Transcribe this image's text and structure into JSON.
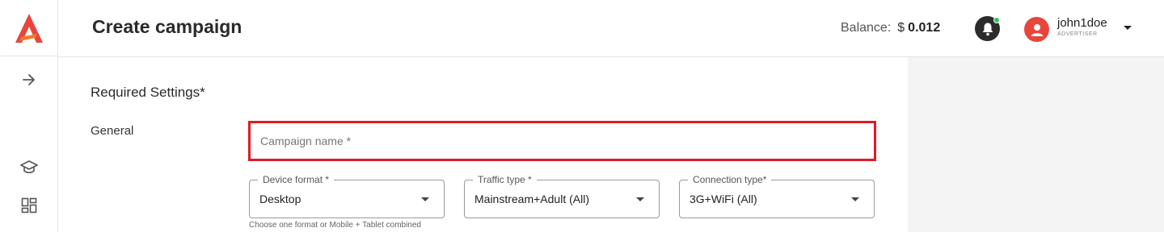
{
  "header": {
    "title": "Create campaign",
    "balance_label": "Balance:",
    "balance_currency": "$",
    "balance_amount": "0.012",
    "notification_dot_color": "#36c25f"
  },
  "user": {
    "username": "john1doe",
    "role": "ADVERTISER",
    "avatar_color": "#e8453c"
  },
  "brand": {
    "logo_color": "#e8453c"
  },
  "sidebar": {
    "items": [
      {
        "icon": "arrow-right-icon"
      },
      {
        "icon": "graduation-cap-icon"
      },
      {
        "icon": "dashboard-grid-icon"
      }
    ]
  },
  "form": {
    "section_title": "Required Settings*",
    "group_label": "General",
    "campaign_name": {
      "placeholder": "Campaign name *",
      "value": "",
      "highlight_color": "#e01b24"
    },
    "selects": [
      {
        "label": "Device format *",
        "value": "Desktop"
      },
      {
        "label": "Traffic type *",
        "value": "Mainstream+Adult (All)"
      },
      {
        "label": "Connection type*",
        "value": "3G+WiFi (All)"
      }
    ],
    "device_helper": "Choose one format or Mobile + Tablet combined"
  }
}
